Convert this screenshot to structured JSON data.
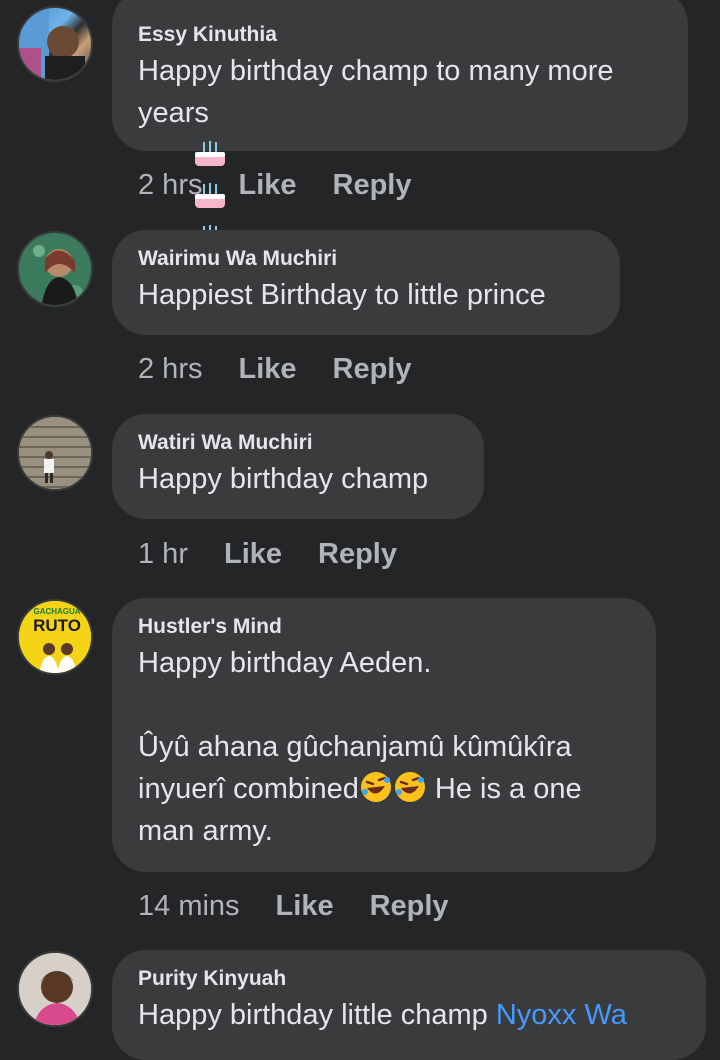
{
  "comments": [
    {
      "author": "Essy Kinuthia",
      "line1": "Happy birthday champ to many more",
      "line2": "years",
      "emojis": [
        "birthday-cake",
        "birthday-cake",
        "birthday-cake"
      ],
      "time": "2 hrs",
      "like": "Like",
      "reply": "Reply"
    },
    {
      "author": "Wairimu Wa Muchiri",
      "text": "Happiest Birthday to little prince",
      "time": "2 hrs",
      "like": "Like",
      "reply": "Reply"
    },
    {
      "author": "Watiri Wa Muchiri",
      "text": "Happy birthday champ",
      "time": "1 hr",
      "like": "Like",
      "reply": "Reply"
    },
    {
      "author": "Hustler's Mind",
      "avatar_text_top": "GACHAGUA",
      "avatar_text_main": "RUTO",
      "line1": "Happy birthday Aeden.",
      "line2": "Ûyû ahana gûchanjamû kûmûkîra",
      "line3a": "inyuerî combined",
      "line3b": " He is a one",
      "line4": "man army.",
      "emojis": [
        "rolling-laughing",
        "rolling-laughing"
      ],
      "time": "14 mins",
      "like": "Like",
      "reply": "Reply"
    },
    {
      "author": "Purity Kinyuah",
      "text": "Happy birthday little champ ",
      "mention": "Nyoxx Wa"
    }
  ],
  "colors": {
    "background": "#242526",
    "bubble": "#3a3b3c",
    "text": "#e4e6eb",
    "secondary": "#b0b3b8",
    "link": "#4599ff"
  }
}
